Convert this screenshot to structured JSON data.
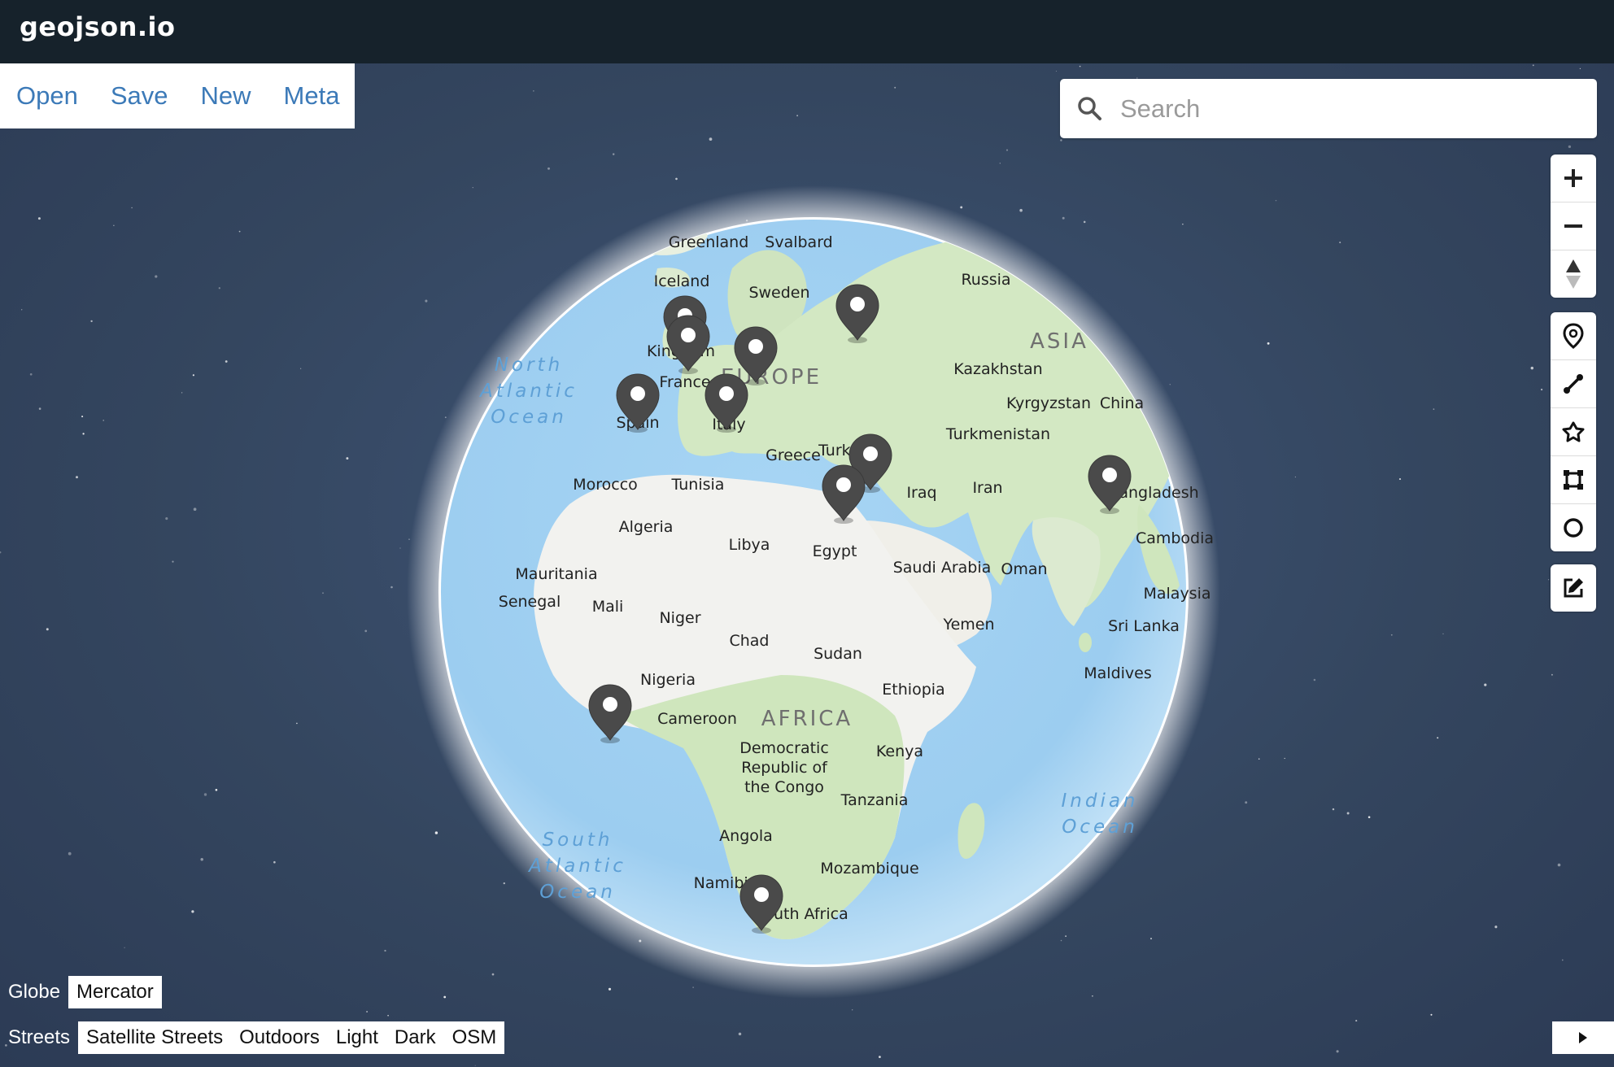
{
  "app": {
    "title": "geojson.io"
  },
  "file_menu": [
    "Open",
    "Save",
    "New",
    "Meta"
  ],
  "search": {
    "placeholder": "Search",
    "value": ""
  },
  "zoom_controls": [
    "zoom-in",
    "zoom-out",
    "compass"
  ],
  "draw_tools": [
    "point",
    "line",
    "polygon",
    "rectangle",
    "circle"
  ],
  "edit_tools": [
    "edit"
  ],
  "projection": {
    "options": [
      "Globe",
      "Mercator"
    ],
    "selected": "Globe"
  },
  "map_styles": {
    "options": [
      "Streets",
      "Satellite Streets",
      "Outdoors",
      "Light",
      "Dark",
      "OSM"
    ],
    "selected": "Streets"
  },
  "map_labels": {
    "countries": [
      "Greenland",
      "Svalbard",
      "Iceland",
      "Sweden",
      "Russia",
      "Kazakhstan",
      "Kyrgyzstan",
      "China",
      "Turkmenistan",
      "Iran",
      "Iraq",
      "Greece",
      "Tunisia",
      "Morocco",
      "Algeria",
      "Libya",
      "Egypt",
      "Saudi Arabia",
      "Oman",
      "Yemen",
      "Mauritania",
      "Senegal",
      "Mali",
      "Niger",
      "Chad",
      "Sudan",
      "Ethiopia",
      "Nigeria",
      "Cameroon",
      "Democratic Republic of the Congo",
      "Kenya",
      "Tanzania",
      "Angola",
      "Mozambique",
      "Cambodia",
      "Malaysia",
      "Sri Lanka",
      "Maldives",
      "France",
      "Spain",
      "Italy",
      "United Kingdom",
      "Bangladesh",
      "Namibia",
      "South Africa",
      "Turkey"
    ],
    "regions": [
      "EUROPE",
      "ASIA",
      "AFRICA"
    ],
    "oceans": [
      "North Atlantic Ocean",
      "South Atlantic Ocean",
      "Indian Ocean"
    ]
  },
  "markers": [
    "marker-uk-1",
    "marker-uk-2",
    "marker-germany",
    "marker-russia",
    "marker-spain",
    "marker-italy",
    "marker-turkey",
    "marker-egypt",
    "marker-bangladesh",
    "marker-gulf-of-guinea",
    "marker-south-africa"
  ]
}
